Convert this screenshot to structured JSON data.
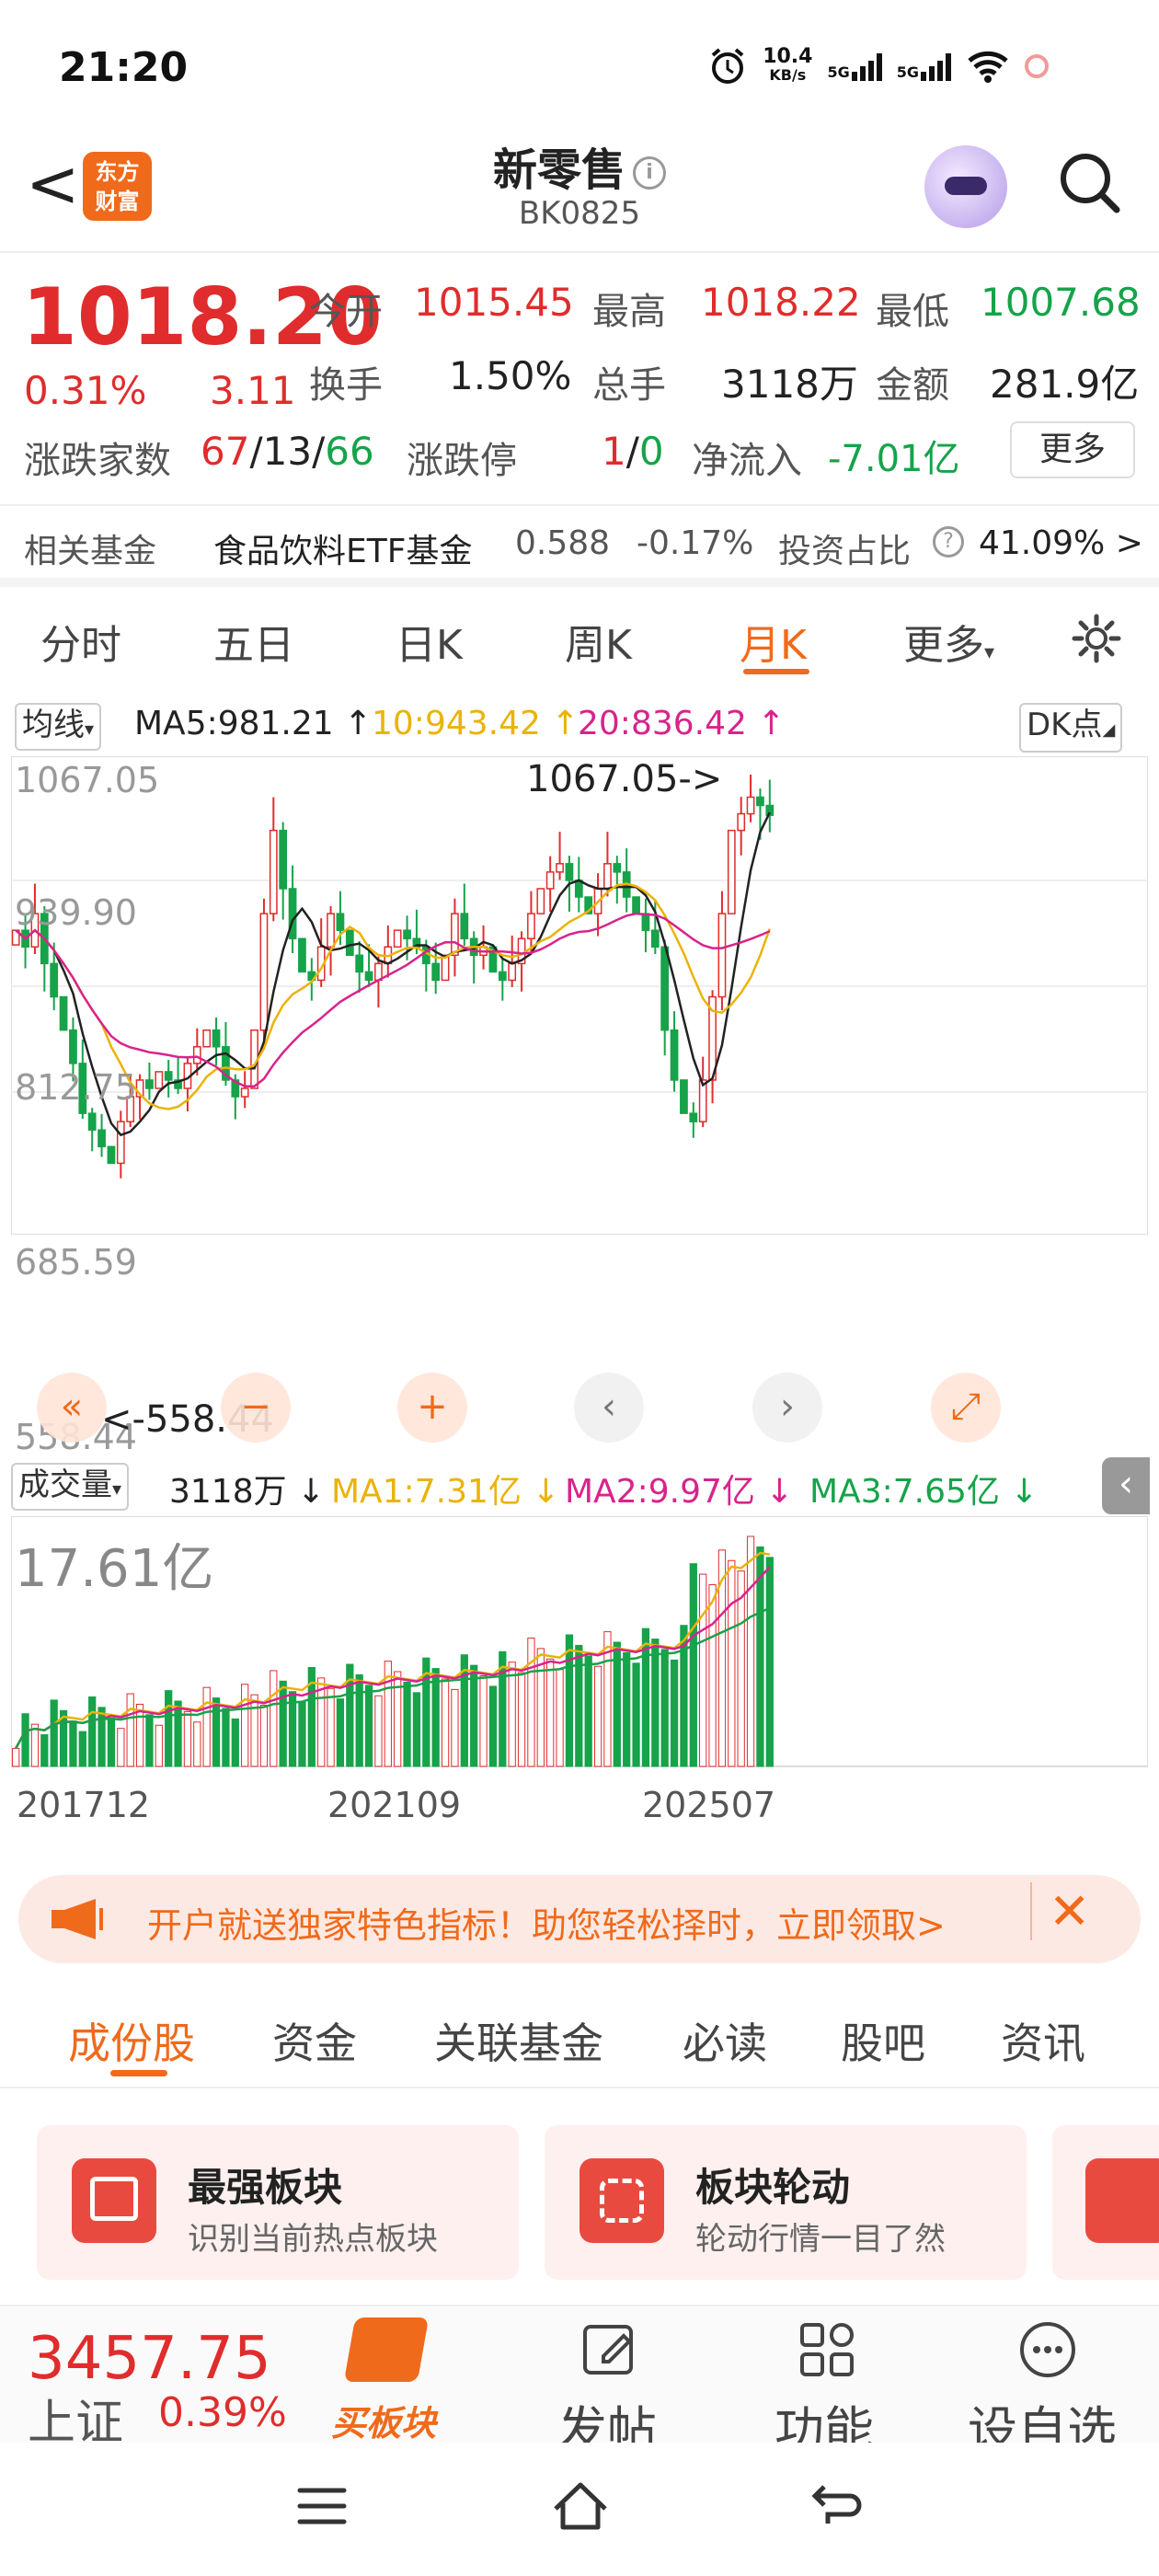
{
  "status": {
    "time": "21:20",
    "net_speed": "10.4",
    "net_unit": "KB/s",
    "sim1": "5G",
    "sim2": "5G"
  },
  "header": {
    "back": "<",
    "logo": "东方\n财富",
    "title": "新零售",
    "code": "BK0825"
  },
  "quote": {
    "price": "1018.20",
    "change_pct": "0.31%",
    "change": "3.11",
    "open_label": "今开",
    "open": "1015.45",
    "high_label": "最高",
    "high": "1018.22",
    "low_label": "最低",
    "low": "1007.68",
    "turnover_label": "换手",
    "turnover": "1.50%",
    "volume_label": "总手",
    "volume": "3118万",
    "amount_label": "金额",
    "amount": "281.9亿",
    "breadth_label": "涨跌家数",
    "up": "67",
    "flat": "13",
    "down": "66",
    "limit_label": "涨跌停",
    "limit_up": "1",
    "limit_down": "0",
    "netflow_label": "净流入",
    "netflow": "-7.01亿",
    "more": "更多"
  },
  "fund": {
    "label": "相关基金",
    "name": "食品饮料ETF基金",
    "price": "0.588",
    "pct": "-0.17%",
    "ratio_label": "投资占比",
    "ratio": "41.09% >"
  },
  "tabs": [
    "分时",
    "五日",
    "日K",
    "周K",
    "月K",
    "更多"
  ],
  "active_tab": "月K",
  "kchart": {
    "ma_btn": "均线",
    "ma5": "MA5:981.21 ↑",
    "ma10": "10:943.42 ↑",
    "ma20": "20:836.42 ↑",
    "dk": "DK点",
    "y_labels": [
      "1067.05",
      "939.90",
      "812.75",
      "685.59",
      "558.44"
    ],
    "max_mark": "1067.05->",
    "min_mark": "<-558.44"
  },
  "volume": {
    "btn": "成交量",
    "cur": "3118万 ↓",
    "ma1": "MA1:7.31亿 ↓",
    "ma2": "MA2:9.97亿 ↓",
    "ma3": "MA3:7.65亿 ↓",
    "max": "17.61亿",
    "x_labels": [
      "201712",
      "202109",
      "202507"
    ]
  },
  "chart_data": {
    "type": "candlestick",
    "period": "monthly",
    "ylim": [
      558.44,
      1067.05
    ],
    "close_series_approx": [
      880,
      860,
      900,
      840,
      800,
      760,
      720,
      660,
      640,
      620,
      600,
      650,
      680,
      700,
      690,
      710,
      700,
      690,
      720,
      740,
      760,
      740,
      700,
      680,
      690,
      760,
      900,
      1000,
      930,
      870,
      830,
      820,
      860,
      900,
      880,
      850,
      830,
      820,
      840,
      860,
      880,
      870,
      860,
      840,
      820,
      850,
      900,
      870,
      850,
      860,
      830,
      820,
      840,
      870,
      900,
      930,
      950,
      960,
      940,
      920,
      900,
      930,
      960,
      950,
      920,
      900,
      880,
      860,
      760,
      700,
      660,
      650,
      700,
      800,
      900,
      1000,
      1020,
      1040,
      1030,
      1018.2
    ],
    "volume_max": "17.61亿"
  },
  "banner": {
    "text": "开户就送独家特色指标！助您轻松择时，立即领取>"
  },
  "sections": [
    "成份股",
    "资金",
    "关联基金",
    "必读",
    "股吧",
    "资讯"
  ],
  "cards": [
    {
      "title": "最强板块",
      "desc": "识别当前热点板块"
    },
    {
      "title": "板块轮动",
      "desc": "轮动行情一目了然"
    }
  ],
  "bottom": {
    "index": "3457.75",
    "index_name": "上证",
    "index_pct": "0.39%",
    "buy": "买板块",
    "post": "发帖",
    "func": "功能",
    "watch": "设自选"
  },
  "colors": {
    "up": "#e02c2c",
    "down": "#16a34a",
    "accent": "#f06a1b"
  }
}
